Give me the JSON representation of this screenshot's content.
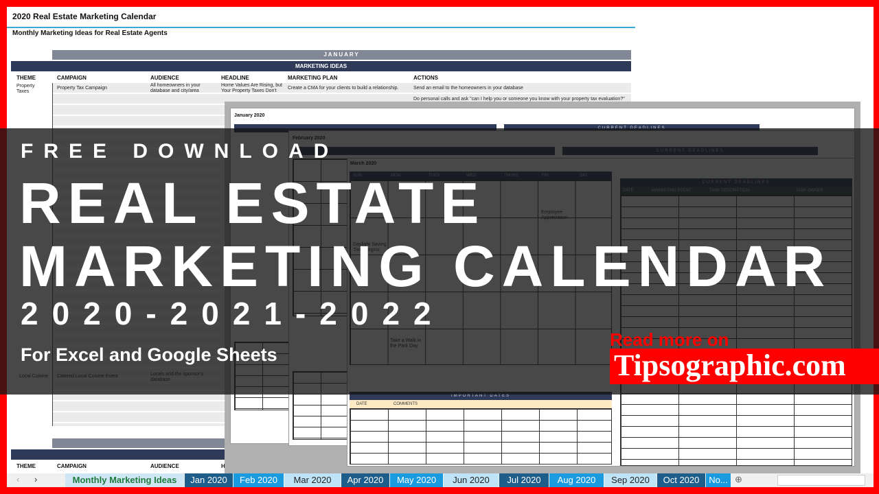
{
  "sheet": {
    "title": "2020 Real Estate Marketing Calendar",
    "subtitle": "Monthly Marketing Ideas for Real Estate Agents",
    "month": "JANUARY",
    "section": "MARKETING IDEAS",
    "headers": [
      "THEME",
      "CAMPAIGN",
      "AUDIENCE",
      "HEADLINE",
      "MARKETING PLAN",
      "ACTIONS"
    ],
    "row1": {
      "theme": "Property Taxes",
      "campaign": "Property Tax Campaign",
      "audience": "All homeowners in your database and city/area",
      "headline": "Home Values Are Rising, but Your Property Taxes Don't",
      "plan": "Create a CMA for your clients to build a relationship.",
      "action1": "Send an email to the homeowners in your database",
      "action2": "Do personal calls and ask \"can I help you or someone you know with your property tax evaluation?\""
    },
    "row3": {
      "theme": "Local Cuisine",
      "campaign": "Catered Local Cuisine Event",
      "audience": "Locals and the sponsor's database"
    }
  },
  "calendars": {
    "jan": {
      "title": "January 2020",
      "deadlines": "CURRENT DEADLINES"
    },
    "feb": {
      "title": "February 2020",
      "deadlines": "CURRENT DEADLINES"
    },
    "mar": {
      "title": "March 2020",
      "deadlines": "CURRENT DEADLINES",
      "days": [
        "SUN",
        "MON",
        "TUES",
        "WED",
        "THURS",
        "FRI",
        "SAT"
      ],
      "deadline_cols": [
        "DATE",
        "MARKETING EVENT",
        "TASK DESCRIPTION",
        "TASK OWNER"
      ],
      "events": {
        "e6": "Employee Appreciation",
        "e8": "Daylight Saving Time Begins",
        "e29": "Take a Walk in the Park Day"
      },
      "important": "IMPORTANT DATES",
      "imp_cols": [
        "DATE",
        "COMMENTS"
      ]
    }
  },
  "overlay": {
    "line1": "FREE DOWNLOAD",
    "line2": "REAL ESTATE",
    "line3": "MARKETING CALENDAR",
    "line4": "2020-2021-2022",
    "line5": "For Excel and Google Sheets",
    "read_more": "Read more on",
    "site": "Tipsographic.com"
  },
  "tabs": [
    "Monthly Marketing Ideas",
    "Jan 2020",
    "Feb 2020",
    "Mar 2020",
    "Apr 2020",
    "May 2020",
    "Jun 2020",
    "Jul 2020",
    "Aug 2020",
    "Sep 2020",
    "Oct 2020",
    "No..."
  ],
  "colors": {
    "accent": "#ff0000",
    "header": "#2e3a57"
  }
}
